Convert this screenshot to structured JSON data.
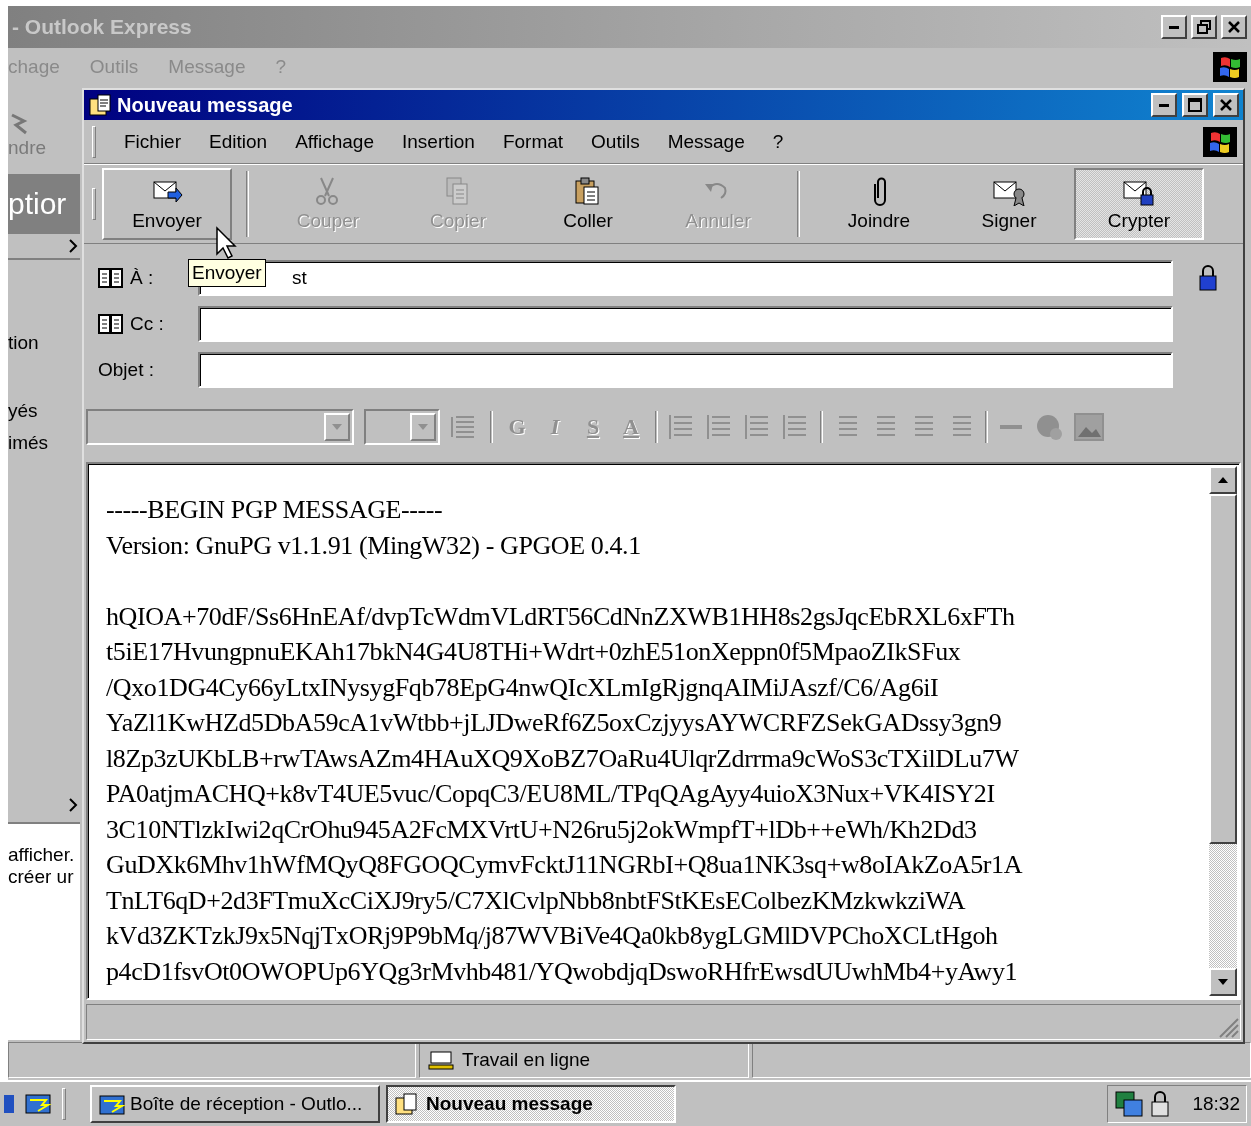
{
  "outer_window": {
    "title": "- Outlook Express",
    "menu": [
      "chage",
      "Outils",
      "Message",
      "?"
    ]
  },
  "outer_left": {
    "toolbar_label": "ndre",
    "pane_title": "ptior",
    "folders": [
      "tion",
      "yés",
      "imés"
    ],
    "contacts_text": [
      "afficher.",
      "créer ur"
    ]
  },
  "compose": {
    "title": "Nouveau message",
    "menu": [
      "Fichier",
      "Edition",
      "Affichage",
      "Insertion",
      "Format",
      "Outils",
      "Message",
      "?"
    ],
    "toolbar": [
      [
        {
          "label": "Envoyer",
          "disabled": false,
          "pressed": false
        }
      ],
      [
        {
          "label": "Couper",
          "disabled": true,
          "pressed": false
        },
        {
          "label": "Copier",
          "disabled": true,
          "pressed": false
        },
        {
          "label": "Coller",
          "disabled": false,
          "pressed": false
        },
        {
          "label": "Annuler",
          "disabled": true,
          "pressed": false
        }
      ],
      [
        {
          "label": "Joindre",
          "disabled": false,
          "pressed": false
        },
        {
          "label": "Signer",
          "disabled": false,
          "pressed": false
        },
        {
          "label": "Crypter",
          "disabled": false,
          "pressed": true
        }
      ]
    ],
    "tooltip": "Envoyer",
    "fields": [
      {
        "label": "À :",
        "address_book": true,
        "value": "st",
        "encrypted": true
      },
      {
        "label": "Cc :",
        "address_book": true,
        "encrypted": false
      },
      {
        "label": "Objet :",
        "address_book": false,
        "encrypted": false
      }
    ],
    "format_bar": {
      "disabled": true,
      "style_buttons": [
        "G",
        "I",
        "S",
        "A"
      ]
    },
    "body_paragraphs": [
      [
        "-----BEGIN PGP MESSAGE-----",
        "Version: GnuPG v1.1.91 (MingW32) - GPGOE 0.4.1"
      ],
      [
        "hQIOA+70dF/Ss6HnEAf/dvpTcWdmVLdRT56CdNnZXWB1HH8s2gsJqcEbRXL6xFTh",
        "t5iE17HvungpnuEKAh17bkN4G4U8THi+Wdrt+0zhE51onXeppn0f5MpaoZIkSFux",
        "/Qxo1DG4Cy66yLtxINysygFqb78EpG4nwQIcXLmIgRjgnqAIMiJAszf/C6/Ag6iI",
        "YaZl1KwHZd5DbA59cA1vWtbb+jLJDweRf6Z5oxCzjyysAYWCRFZSekGADssy3gn9",
        "l8Zp3zUKbLB+rwTAwsAZm4HAuXQ9XoBZ7OaRu4UlqrZdrrma9cWoS3cTXilDLu7W",
        "PA0atjmACHQ+k8vT4UE5vuc/CopqC3/EU8ML/TPqQAgAyy4uioX3Nux+VK4ISY2I",
        "3C10NTlzkIwi2qCrOhu945A2FcMXVrtU+N26ru5j2okWmpfT+lDb++eWh/Kh2Dd3",
        "GuDXk6Mhv1hWfMQyQ8FGOQCymvFcktJ11NGRbI+Q8ua1NK3sq+w8oIAkZoA5r1A",
        "TnLT6qD+2d3FTmuXcCiXJ9ry5/C7XlCvlpNbb8nbtFStKEsEColbezKMzkwkziWA",
        "kVd3ZKTzkJ9x5NqjTxORj9P9bMq/j87WVBiVe4Qa0kb8ygLGMlDVPChoXCLtHgoh",
        "p4cD1fsvOt0OWOPUp6YQg3rMvhb481/YQwobdjqDswoRHfrEwsdUUwhMb4+yAwy1"
      ]
    ]
  },
  "status_bar": {
    "connection": "Travail en ligne"
  },
  "taskbar": {
    "tasks": [
      {
        "label": "Boîte de réception - Outlo...",
        "selected": false
      },
      {
        "label": "Nouveau message",
        "selected": true
      }
    ],
    "clock": "18:32"
  }
}
